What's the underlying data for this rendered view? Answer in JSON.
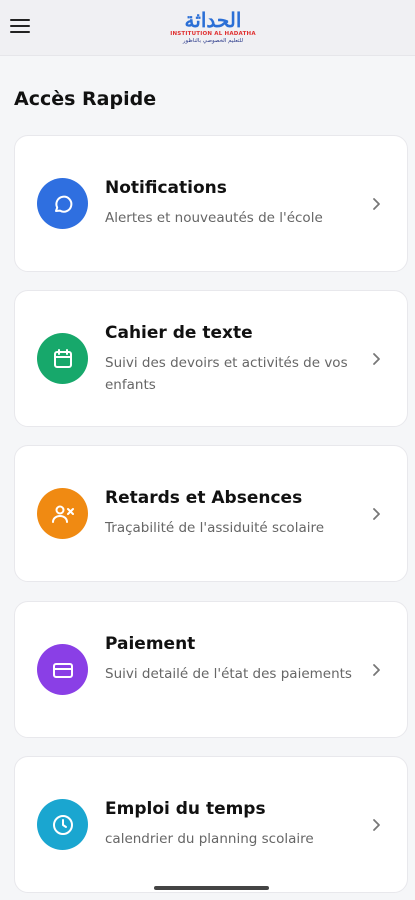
{
  "header": {
    "logo_arabic": "الحداثة",
    "logo_latin": "INSTITUTION AL HADATHA",
    "logo_tagline": "للتعليم الخصوصي بالناظور"
  },
  "section_title": "Accès Rapide",
  "cards": [
    {
      "title": "Notifications",
      "description": "Alertes et nouveautés de l'école",
      "icon": "chat-bubble-icon",
      "color": "#2f6fe0"
    },
    {
      "title": "Cahier de texte",
      "description": "Suivi des devoirs et activités de vos enfants",
      "icon": "calendar-icon",
      "color": "#17a86b"
    },
    {
      "title": "Retards et Absences",
      "description": "Traçabilité de l'assiduité scolaire",
      "icon": "user-x-icon",
      "color": "#f08a12"
    },
    {
      "title": "Paiement",
      "description": "Suivi detailé de l'état des paiements",
      "icon": "credit-card-icon",
      "color": "#8a3fe6"
    },
    {
      "title": "Emploi du temps",
      "description": "calendrier du planning scolaire",
      "icon": "clock-icon",
      "color": "#1aa6d0"
    }
  ]
}
